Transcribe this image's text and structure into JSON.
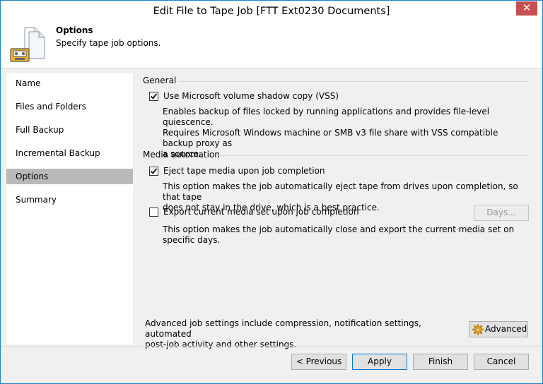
{
  "window": {
    "title": "Edit File to Tape Job [FTT Ext0230 Documents]",
    "close_glyph": "✕"
  },
  "header": {
    "title": "Options",
    "subtitle": "Specify tape job options."
  },
  "sidebar": {
    "items": [
      {
        "label": "Name"
      },
      {
        "label": "Files and Folders"
      },
      {
        "label": "Full Backup"
      },
      {
        "label": "Incremental Backup"
      },
      {
        "label": "Options",
        "active": true
      },
      {
        "label": "Summary"
      }
    ]
  },
  "general": {
    "label": "General",
    "vss": {
      "label": "Use Microsoft volume shadow copy (VSS)",
      "checked": true,
      "desc1": "Enables backup of files locked by running applications and provides file-level quiescence.",
      "desc2": "Requires Microsoft Windows machine or SMB v3 file share with VSS compatible backup proxy as",
      "desc3": "a source."
    }
  },
  "media": {
    "label": "Media automation",
    "eject": {
      "label": "Eject tape media upon job completion",
      "checked": true,
      "desc1": "This option makes the job automatically eject tape from drives upon completion, so that tape",
      "desc2": "does not stay in the drive, which is a best practice."
    },
    "export": {
      "label": "Export current media set upon job completion",
      "checked": false,
      "desc1": "This option makes the job automatically close and export the current media set on specific days.",
      "days_button": "Days..."
    }
  },
  "advanced": {
    "text1": "Advanced job settings include compression, notification settings, automated",
    "text2": "post-job activity and other settings.",
    "button": "Advanced"
  },
  "footer": {
    "previous": "< Previous",
    "apply": "Apply",
    "finish": "Finish",
    "cancel": "Cancel"
  },
  "colors": {
    "accent": "#0078d7",
    "close": "#c75050",
    "active_nav": "#b9b9b9"
  }
}
